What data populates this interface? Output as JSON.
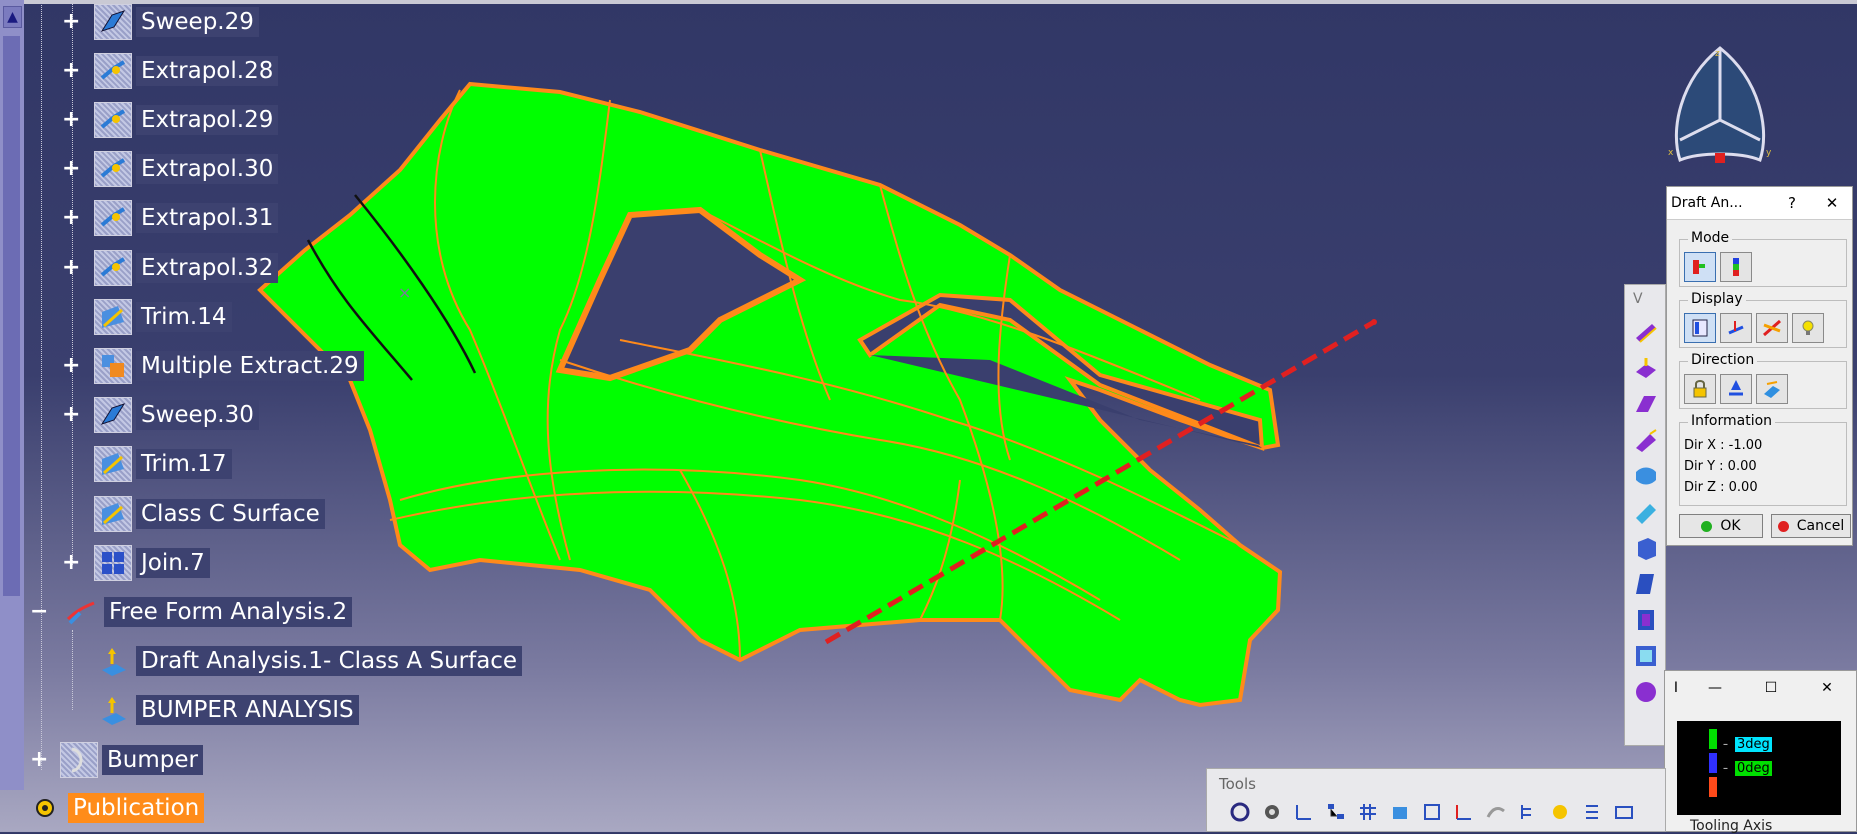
{
  "tree": {
    "items": [
      {
        "label": "Sweep.29",
        "expander": "+",
        "icon": "sweep-icon"
      },
      {
        "label": "Extrapol.28",
        "expander": "+",
        "icon": "extrapol-icon"
      },
      {
        "label": "Extrapol.29",
        "expander": "+",
        "icon": "extrapol-icon"
      },
      {
        "label": "Extrapol.30",
        "expander": "+",
        "icon": "extrapol-icon"
      },
      {
        "label": "Extrapol.31",
        "expander": "+",
        "icon": "extrapol-icon"
      },
      {
        "label": "Extrapol.32",
        "expander": "+",
        "icon": "extrapol-icon"
      },
      {
        "label": "Trim.14",
        "expander": "",
        "icon": "trim-icon"
      },
      {
        "label": "Multiple Extract.29",
        "expander": "+",
        "icon": "extract-icon"
      },
      {
        "label": "Sweep.30",
        "expander": "+",
        "icon": "sweep-icon"
      },
      {
        "label": "Trim.17",
        "expander": "",
        "icon": "trim-icon"
      },
      {
        "label": "Class C Surface",
        "expander": "",
        "icon": "surface-icon"
      },
      {
        "label": "Join.7",
        "expander": "+",
        "icon": "join-icon"
      },
      {
        "label": "Free Form Analysis.2",
        "expander": "−",
        "icon": "freeform-analysis-icon"
      },
      {
        "label": "Draft Analysis.1- Class A Surface",
        "expander": "",
        "icon": "draft-analysis-icon"
      },
      {
        "label": "BUMPER ANALYSIS",
        "expander": "",
        "icon": "draft-analysis-icon"
      },
      {
        "label": "Bumper",
        "expander": "+",
        "icon": "body-icon"
      },
      {
        "label": "Publication",
        "expander": "",
        "icon": "publication-icon"
      }
    ]
  },
  "compass": {
    "axis_x": "x",
    "axis_y": "y",
    "axis_z": "z"
  },
  "draft_dialog": {
    "title": "Draft An...",
    "help": "?",
    "close": "✕",
    "mode_label": "Mode",
    "display_label": "Display",
    "direction_label": "Direction",
    "information_label": "Information",
    "dir_x": "Dir X : -1.00",
    "dir_y": "Dir Y : 0.00",
    "dir_z": "Dir Z : 0.00",
    "ok": "OK",
    "cancel": "Cancel"
  },
  "view_toolbar": {
    "title": "V"
  },
  "scale_window": {
    "title": "I",
    "minimize": "—",
    "maximize": "☐",
    "close": "✕",
    "value_top": "3deg",
    "value_bottom": "0deg",
    "colors": {
      "top": "#00e000",
      "middle": "#3030ff",
      "bottom": "#ff4a1a"
    }
  },
  "tools_toolbar": {
    "title": "Tools",
    "tooling_axis": "Tooling Axis"
  },
  "colors": {
    "surface": "#00ff00",
    "edges": "#ff8a1a",
    "axis_line": "#e02020",
    "background_top": "#313766",
    "selection": "#ff8c1a"
  }
}
